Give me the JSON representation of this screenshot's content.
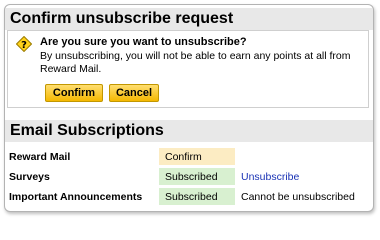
{
  "confirm_section": {
    "title": "Confirm unsubscribe request",
    "question": "Are you sure you want to unsubscribe?",
    "description": "By unsubscribing, you will not be able to earn any points at all from Reward Mail.",
    "confirm_label": "Confirm",
    "cancel_label": "Cancel"
  },
  "subscriptions": {
    "title": "Email Subscriptions",
    "rows": [
      {
        "name": "Reward Mail",
        "status": "Confirm",
        "action": ""
      },
      {
        "name": "Surveys",
        "status": "Subscribed",
        "action": "Unsubscribe"
      },
      {
        "name": "Important Announcements",
        "status": "Subscribed",
        "action": "Cannot be unsubscribed"
      }
    ]
  },
  "colors": {
    "header_bg": "#e8e8e8",
    "button": "#f5b800",
    "pending_status": "#fcecc3",
    "subscribed_status": "#d8f0d0",
    "link": "#1a33b5"
  },
  "icons": {
    "warning": "question-mark-warning-icon"
  }
}
